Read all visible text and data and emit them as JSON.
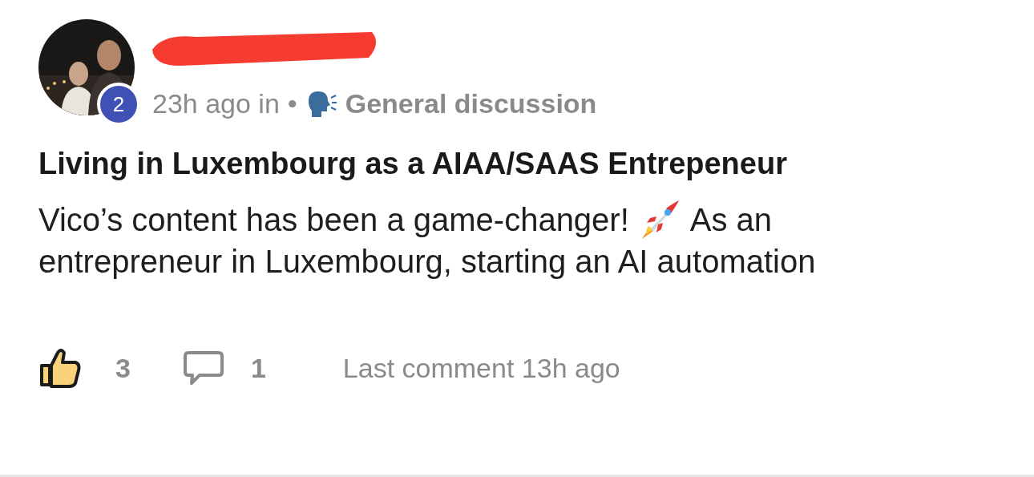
{
  "author": {
    "badge": "2",
    "time": "23h ago in",
    "separator": "•",
    "category": "General discussion"
  },
  "post": {
    "title": "Living in Luxembourg as a AIAA/SAAS Entrepeneur",
    "body": [
      {
        "kind": "text",
        "text": "Vico’s content has been a game-changer!"
      },
      {
        "kind": "emoji"
      },
      {
        "kind": "text",
        "text": "As an"
      },
      {
        "kind": "break"
      },
      {
        "kind": "text",
        "text": "entrepreneur in Luxembourg, starting an AI automation"
      }
    ]
  },
  "footer": {
    "liked": true,
    "likes": "3",
    "comments": "1",
    "last_comment": "Last comment 13h ago"
  }
}
